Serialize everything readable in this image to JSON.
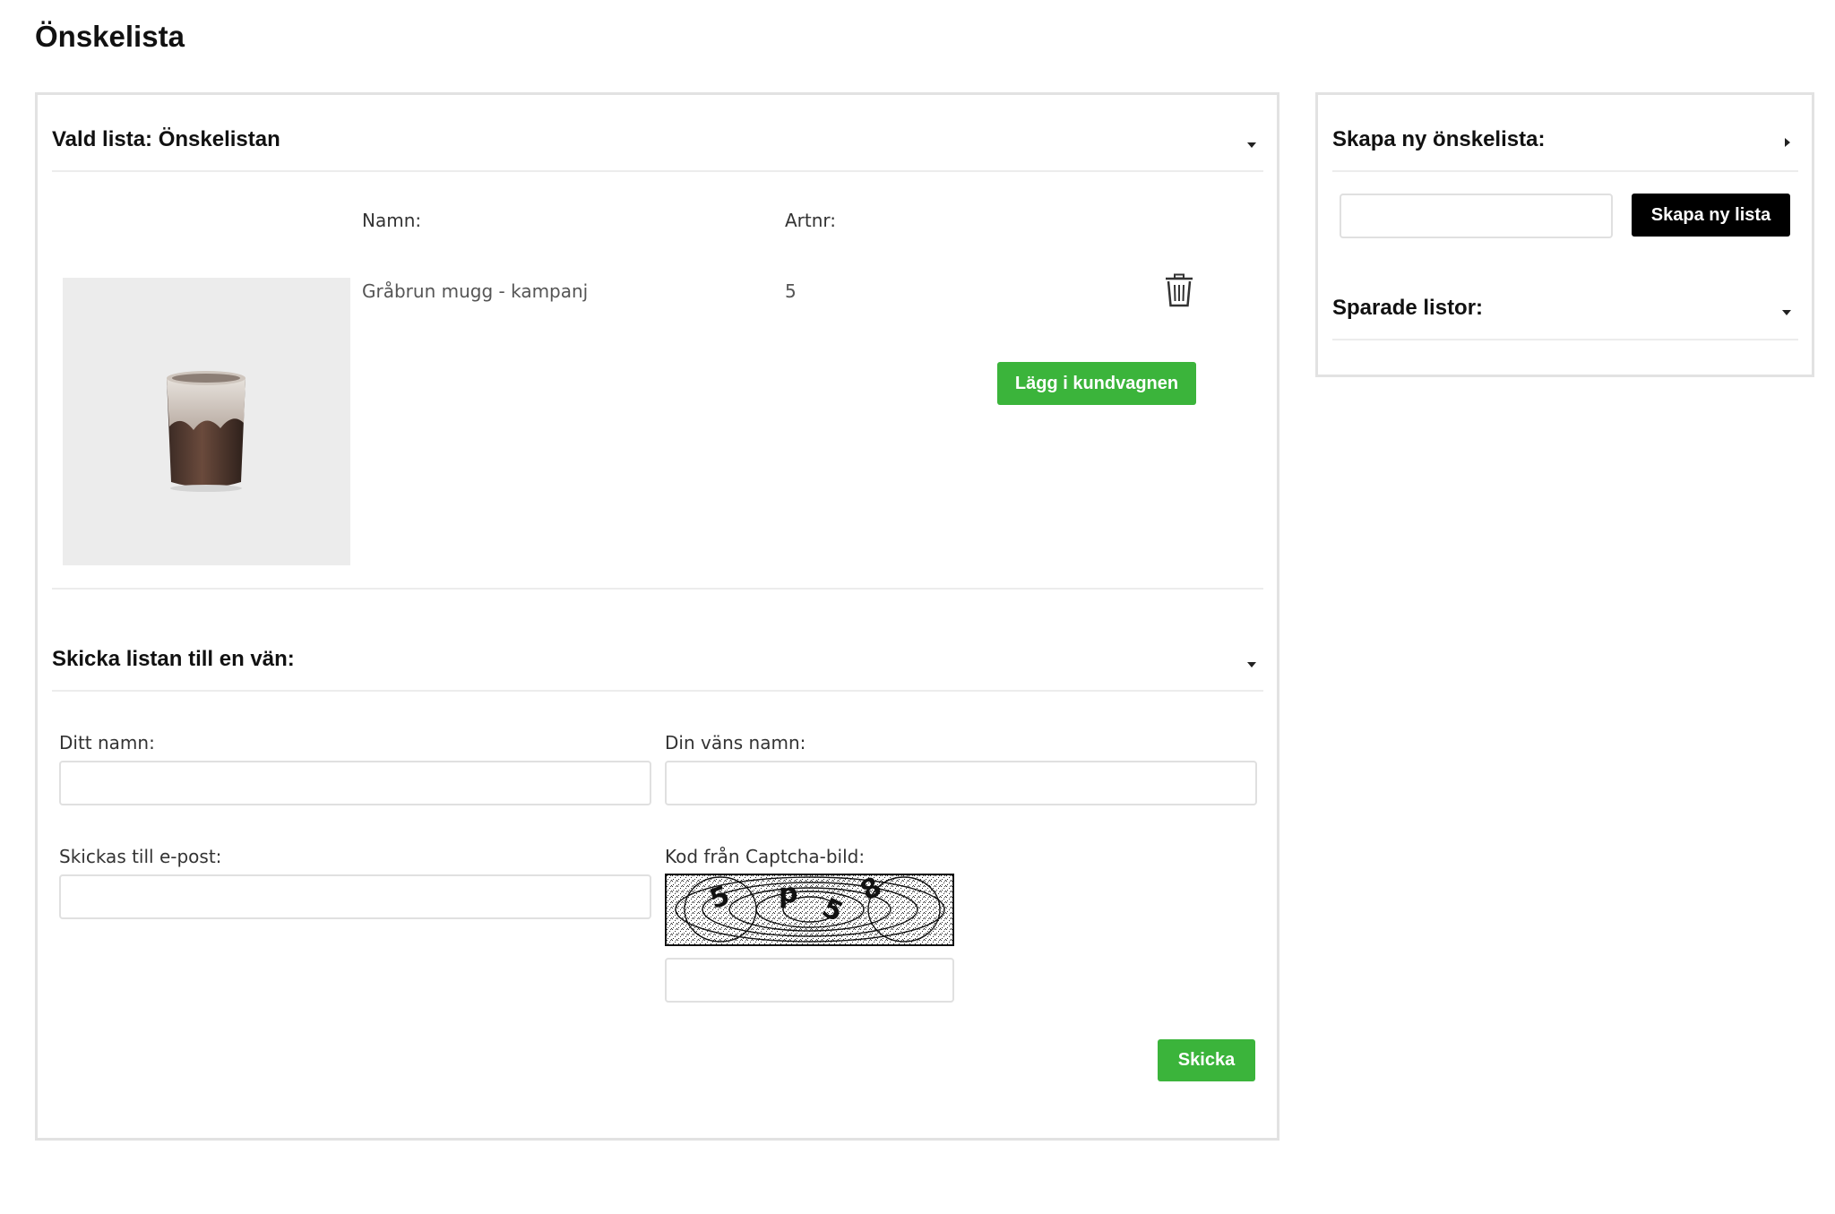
{
  "page": {
    "title": "Önskelista"
  },
  "wishlist": {
    "heading": "Vald lista: Önskelistan",
    "columns": {
      "name": "Namn:",
      "artnr": "Artnr:"
    },
    "item": {
      "name": "Gråbrun mugg - kampanj",
      "artnr": "5",
      "add_to_cart_label": "Lägg i kundvagnen"
    }
  },
  "share": {
    "heading": "Skicka listan till en vän:",
    "your_name_label": "Ditt namn:",
    "your_name_value": "",
    "friend_name_label": "Din väns namn:",
    "friend_name_value": "",
    "email_label": "Skickas till e-post:",
    "email_value": "",
    "captcha_label": "Kod från Captcha-bild:",
    "captcha_value": "",
    "submit_label": "Skicka"
  },
  "sidebar": {
    "create_heading": "Skapa ny önskelista:",
    "create_input_value": "",
    "create_button_label": "Skapa ny lista",
    "saved_heading": "Sparade listor:"
  },
  "colors": {
    "accent_green": "#3bb43b",
    "button_black": "#000000",
    "border": "#e2e2e2"
  }
}
